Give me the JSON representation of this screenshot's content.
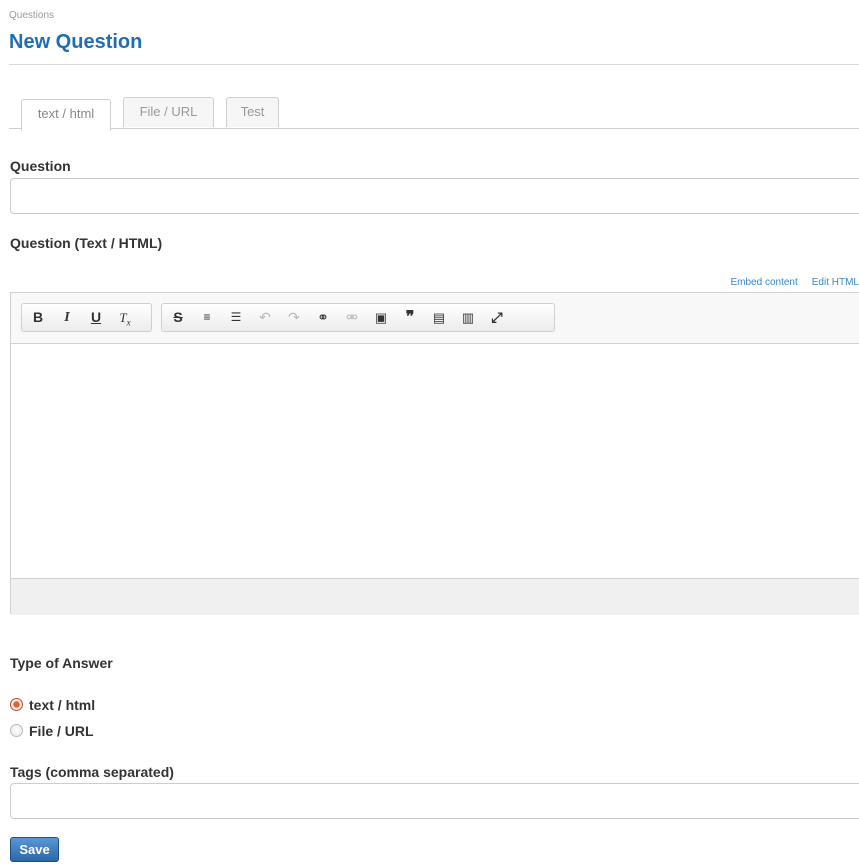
{
  "breadcrumb": "Questions",
  "page_title": "New Question",
  "tabs": [
    {
      "label": "text / html",
      "active": true
    },
    {
      "label": "File / URL",
      "active": false
    },
    {
      "label": "Test",
      "active": false
    }
  ],
  "question": {
    "label": "Question",
    "value": ""
  },
  "question_html": {
    "label": "Question (Text / HTML)",
    "links": {
      "embed": "Embed content",
      "edit_html": "Edit HTML"
    },
    "toolbar": [
      {
        "icon": "bold-icon",
        "glyph": "B"
      },
      {
        "icon": "italic-icon",
        "glyph": "I"
      },
      {
        "icon": "underline-icon",
        "glyph": "U"
      },
      {
        "icon": "remove-format-icon",
        "glyph": "Tx"
      },
      {
        "icon": "strikethrough-icon",
        "glyph": "S"
      },
      {
        "icon": "numbered-list-icon",
        "glyph": "≡"
      },
      {
        "icon": "bulleted-list-icon",
        "glyph": "☰"
      },
      {
        "icon": "undo-icon",
        "glyph": "↶"
      },
      {
        "icon": "redo-icon",
        "glyph": "↷"
      },
      {
        "icon": "link-icon",
        "glyph": "⚭"
      },
      {
        "icon": "unlink-icon",
        "glyph": "⚮"
      },
      {
        "icon": "image-icon",
        "glyph": "▣"
      },
      {
        "icon": "blockquote-icon",
        "glyph": "❞"
      },
      {
        "icon": "paste-text-icon",
        "glyph": "▤"
      },
      {
        "icon": "paste-word-icon",
        "glyph": "▥"
      },
      {
        "icon": "maximize-icon",
        "glyph": "⤢"
      }
    ]
  },
  "answer_type": {
    "label": "Type of Answer",
    "options": [
      {
        "label": "text / html",
        "checked": true
      },
      {
        "label": "File / URL",
        "checked": false
      }
    ]
  },
  "tags": {
    "label": "Tags (comma separated)",
    "value": ""
  },
  "save_label": "Save"
}
